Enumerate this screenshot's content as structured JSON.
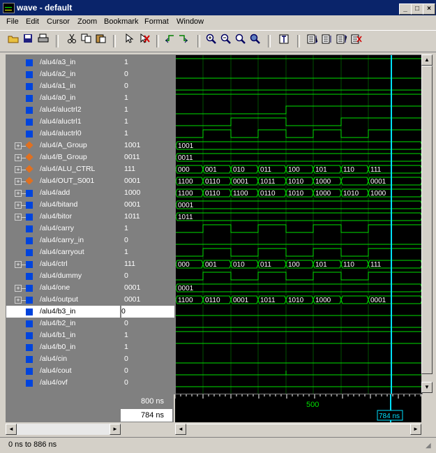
{
  "window": {
    "title": "wave - default",
    "minimize": "_",
    "maximize": "□",
    "close": "×"
  },
  "menu": [
    "File",
    "Edit",
    "Cursor",
    "Zoom",
    "Bookmark",
    "Format",
    "Window"
  ],
  "signals": [
    {
      "name": "/alu4/a3_in",
      "value": "1",
      "kind": "bit",
      "expand": false
    },
    {
      "name": "/alu4/a2_in",
      "value": "0",
      "kind": "bit",
      "expand": false
    },
    {
      "name": "/alu4/a1_in",
      "value": "0",
      "kind": "bit",
      "expand": false
    },
    {
      "name": "/alu4/a0_in",
      "value": "1",
      "kind": "bit",
      "expand": false
    },
    {
      "name": "/alu4/aluctrl2",
      "value": "1",
      "kind": "bit",
      "expand": false
    },
    {
      "name": "/alu4/aluctrl1",
      "value": "1",
      "kind": "bit",
      "expand": false
    },
    {
      "name": "/alu4/aluctrl0",
      "value": "1",
      "kind": "bit",
      "expand": false
    },
    {
      "name": "/alu4/A_Group",
      "value": "1001",
      "kind": "group",
      "expand": true
    },
    {
      "name": "/alu4/B_Group",
      "value": "0011",
      "kind": "group",
      "expand": true
    },
    {
      "name": "/alu4/ALU_CTRL",
      "value": "111",
      "kind": "group",
      "expand": true
    },
    {
      "name": "/alu4/OUT_S001",
      "value": "0001",
      "kind": "group",
      "expand": true
    },
    {
      "name": "/alu4/add",
      "value": "1000",
      "kind": "bus",
      "expand": true
    },
    {
      "name": "/alu4/bitand",
      "value": "0001",
      "kind": "bus",
      "expand": true
    },
    {
      "name": "/alu4/bitor",
      "value": "1011",
      "kind": "bus",
      "expand": true
    },
    {
      "name": "/alu4/carry",
      "value": "1",
      "kind": "bit",
      "expand": false
    },
    {
      "name": "/alu4/carry_in",
      "value": "0",
      "kind": "bit",
      "expand": false
    },
    {
      "name": "/alu4/carryout",
      "value": "1",
      "kind": "bit",
      "expand": false
    },
    {
      "name": "/alu4/ctrl",
      "value": "111",
      "kind": "bus",
      "expand": true
    },
    {
      "name": "/alu4/dummy",
      "value": "0",
      "kind": "bit",
      "expand": false
    },
    {
      "name": "/alu4/one",
      "value": "0001",
      "kind": "bus",
      "expand": true
    },
    {
      "name": "/alu4/output",
      "value": "0001",
      "kind": "bus",
      "expand": true
    },
    {
      "name": "/alu4/b3_in",
      "value": "0",
      "kind": "bit",
      "expand": false,
      "selected": true
    },
    {
      "name": "/alu4/b2_in",
      "value": "0",
      "kind": "bit",
      "expand": false
    },
    {
      "name": "/alu4/b1_in",
      "value": "1",
      "kind": "bit",
      "expand": false
    },
    {
      "name": "/alu4/b0_in",
      "value": "1",
      "kind": "bit",
      "expand": false
    },
    {
      "name": "/alu4/cin",
      "value": "0",
      "kind": "bit",
      "expand": false
    },
    {
      "name": "/alu4/cout",
      "value": "0",
      "kind": "bit",
      "expand": false
    },
    {
      "name": "/alu4/ovf",
      "value": "0",
      "kind": "bit",
      "expand": false
    }
  ],
  "bus_waves": {
    "A_Group": [
      "1001"
    ],
    "B_Group": [
      "0011"
    ],
    "ALU_CTRL": [
      "000",
      "001",
      "010",
      "011",
      "100",
      "101",
      "110",
      "111"
    ],
    "OUT_S001": [
      "1100",
      "0110",
      "0001",
      "1011",
      "1010",
      "1000",
      "",
      "0001"
    ],
    "add": [
      "1100",
      "0110",
      "1100",
      "0110",
      "1010",
      "1000",
      "1010",
      "1000"
    ],
    "bitand": [
      "0001"
    ],
    "bitor": [
      "1011"
    ],
    "ctrl": [
      "000",
      "001",
      "010",
      "011",
      "100",
      "101",
      "110",
      "111"
    ],
    "one": [
      "0001"
    ],
    "output": [
      "1100",
      "0110",
      "0001",
      "1011",
      "1010",
      "1000",
      "",
      "0001"
    ]
  },
  "cursor": {
    "now_label": "800 ns",
    "cursor_label": "784 ns",
    "tick_label": "500",
    "cursor_flag": "784 ns"
  },
  "status": "0 ns to 886 ns",
  "colors": {
    "wave": "#00e000",
    "cursor": "#00e0ff",
    "grid": "#005000",
    "selected": "#ffffff"
  }
}
